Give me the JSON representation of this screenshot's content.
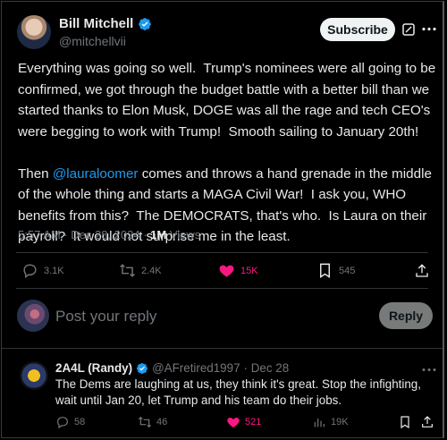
{
  "tweet": {
    "author_name": "Bill Mitchell",
    "author_handle": "@mitchellvii",
    "subscribe_label": "Subscribe",
    "text_part1": "Everything was going so well.  Trump's nominees were all going to be confirmed, we got through the budget battle with a better bill than we started thanks to Elon Musk, DOGE was all the rage and tech CEO's were begging to work with Trump!  Smooth sailing to January 20th!\n\nThen ",
    "mention": "@lauraloomer",
    "text_part2": " comes and throws a hand grenade in the middle of the whole thing and starts a MAGA Civil War!  I ask you, WHO benefits from this?  The DEMOCRATS, that's who.  Is Laura on their payroll?  It would not surprise me in the least.",
    "timestamp": "5:57 AM · Dec 28, 2024 · ",
    "views_count": "1M",
    "views_label": " Views",
    "actions": {
      "replies": "3.1K",
      "reposts": "2.4K",
      "likes": "15K",
      "bookmarks": "545"
    }
  },
  "reply_box": {
    "placeholder": "Post your reply",
    "button_label": "Reply"
  },
  "comment": {
    "author_name": "2A4L (Randy)",
    "author_handle": "@AFretired1997",
    "date": "· Dec 28",
    "text": "The Dems are laughing at us, they think it's great. Stop the infighting, wait until Jan 20, let Trump and his team do their jobs.",
    "actions": {
      "replies": "58",
      "reposts": "46",
      "likes": "521",
      "views": "19K"
    }
  },
  "colors": {
    "background": "#000000",
    "text": "#e7e9ea",
    "muted": "#71767b",
    "accent": "#1d9bf0",
    "like": "#f91880"
  }
}
